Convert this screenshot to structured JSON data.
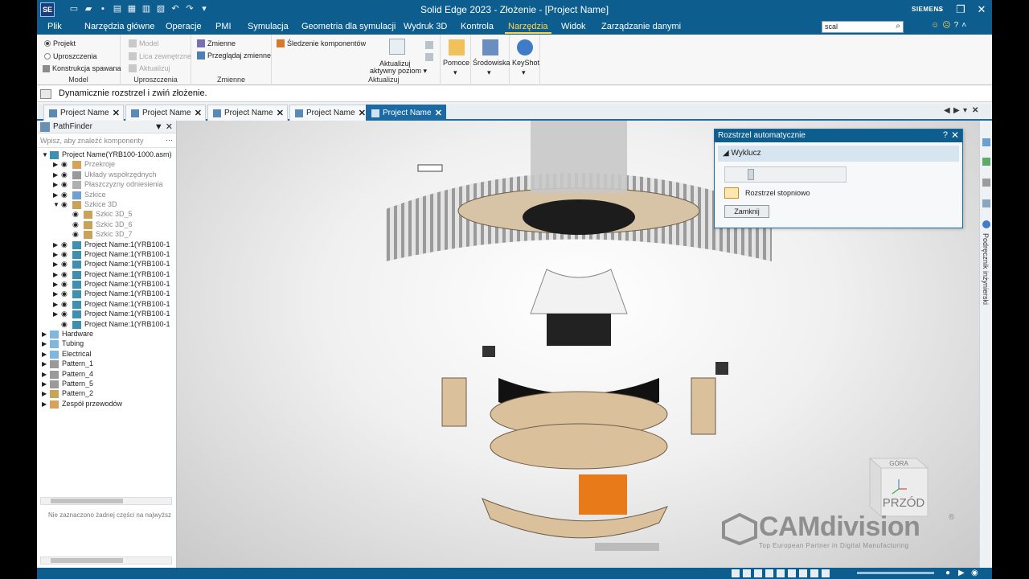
{
  "app": {
    "title": "Solid Edge 2023 - Złożenie - [Project Name]",
    "brand": "SIEMENS",
    "logo_text": "SE"
  },
  "ribbon_tabs": [
    {
      "label": "Plik"
    },
    {
      "label": "Narzędzia główne"
    },
    {
      "label": "Operacje"
    },
    {
      "label": "PMI"
    },
    {
      "label": "Symulacja"
    },
    {
      "label": "Geometria dla symulacji"
    },
    {
      "label": "Wydruk 3D"
    },
    {
      "label": "Kontrola"
    },
    {
      "label": "Narzędzia",
      "active": true
    },
    {
      "label": "Widok"
    },
    {
      "label": "Zarządzanie danymi"
    }
  ],
  "search": {
    "value": "scal"
  },
  "ribbon": {
    "model": {
      "label": "Model",
      "projekt": "Projekt",
      "uproszczenia": "Uproszczenia",
      "konstrukcja": "Konstrukcja spawana"
    },
    "uproszczenia": {
      "label": "Uproszczenia",
      "model": "Model",
      "lica": "Lica zewnętrzne",
      "aktualizuj": "Aktualizuj"
    },
    "zmienne": {
      "label": "Zmienne",
      "zmienne": "Zmienne",
      "przegladaj": "Przeglądaj zmienne"
    },
    "aktualizuj": {
      "label": "Aktualizuj",
      "sledzenie": "Śledzenie komponentów",
      "aktywny_line1": "Aktualizuj",
      "aktywny_line2": "aktywny poziom ▾"
    },
    "pomoce": "Pomoce",
    "srodowiska": "Środowiska",
    "keyshot": "KeyShot"
  },
  "command_bar": {
    "text": "Dynamicznie rozstrzel i zwiń złożenie."
  },
  "doc_tabs": [
    {
      "label": "Project Name"
    },
    {
      "label": "Project Name"
    },
    {
      "label": "Project Name"
    },
    {
      "label": "Project Name"
    },
    {
      "label": "Project Name",
      "active": true
    }
  ],
  "pathfinder": {
    "title": "PathFinder",
    "filter_placeholder": "Wpisz, aby znaleźć komponenty",
    "status": "Nie zaznaczono żadnej części na najwyższ",
    "tree": [
      {
        "label": "Project Name(YRB100-1000.asm)",
        "level": 0,
        "exp": "▼",
        "icon": "asm"
      },
      {
        "label": "Przekroje",
        "level": 1,
        "exp": "▶",
        "icon": "section",
        "grey": true
      },
      {
        "label": "Układy współrzędnych",
        "level": 1,
        "exp": "▶",
        "icon": "coord",
        "grey": true
      },
      {
        "label": "Płaszczyzny odniesienia",
        "level": 1,
        "exp": "▶",
        "icon": "plane",
        "grey": true
      },
      {
        "label": "Szkice",
        "level": 1,
        "exp": "▶",
        "icon": "sketch",
        "grey": true
      },
      {
        "label": "Szkice 3D",
        "level": 1,
        "exp": "▼",
        "icon": "sketch3d",
        "grey": true
      },
      {
        "label": "Szkic 3D_5",
        "level": 2,
        "exp": "",
        "icon": "sketch3d",
        "grey": true
      },
      {
        "label": "Szkic 3D_6",
        "level": 2,
        "exp": "",
        "icon": "sketch3d",
        "grey": true
      },
      {
        "label": "Szkic 3D_7",
        "level": 2,
        "exp": "",
        "icon": "sketch3d",
        "grey": true
      },
      {
        "label": "Project Name:1(YRB100-1",
        "level": 1,
        "exp": "▶",
        "icon": "part"
      },
      {
        "label": "Project Name:1(YRB100-1",
        "level": 1,
        "exp": "▶",
        "icon": "part"
      },
      {
        "label": "Project Name:1(YRB100-1",
        "level": 1,
        "exp": "▶",
        "icon": "part"
      },
      {
        "label": "Project Name:1(YRB100-1",
        "level": 1,
        "exp": "▶",
        "icon": "part"
      },
      {
        "label": "Project Name:1(YRB100-1",
        "level": 1,
        "exp": "▶",
        "icon": "part"
      },
      {
        "label": "Project Name:1(YRB100-1",
        "level": 1,
        "exp": "▶",
        "icon": "part"
      },
      {
        "label": "Project Name:1(YRB100-1",
        "level": 1,
        "exp": "▶",
        "icon": "part"
      },
      {
        "label": "Project Name:1(YRB100-1",
        "level": 1,
        "exp": "▶",
        "icon": "part"
      },
      {
        "label": "Project Name:1(YRB100-1",
        "level": 1,
        "exp": "",
        "icon": "part"
      },
      {
        "label": "Hardware",
        "level": 0,
        "exp": "▶",
        "icon": "folder",
        "noeye": true
      },
      {
        "label": "Tubing",
        "level": 0,
        "exp": "▶",
        "icon": "folder",
        "noeye": true
      },
      {
        "label": "Electrical",
        "level": 0,
        "exp": "▶",
        "icon": "folder",
        "noeye": true
      },
      {
        "label": "Pattern_1",
        "level": 0,
        "exp": "▶",
        "icon": "pattern",
        "noeye": true
      },
      {
        "label": "Pattern_4",
        "level": 0,
        "exp": "▶",
        "icon": "pattern",
        "noeye": true
      },
      {
        "label": "Pattern_5",
        "level": 0,
        "exp": "▶",
        "icon": "pattern",
        "noeye": true
      },
      {
        "label": "Pattern_2",
        "level": 0,
        "exp": "▶",
        "icon": "pattern2",
        "noeye": true
      },
      {
        "label": "Zespół przewodów",
        "level": 0,
        "exp": "▶",
        "icon": "wire",
        "noeye": true
      }
    ]
  },
  "dialog": {
    "title": "Rozstrzel automatycznie",
    "section": "Wyklucz",
    "option": "Rozstrzel stopniowo",
    "close_button": "Zamknij",
    "help": "?",
    "close_x": "✕",
    "slider_value": 0.2
  },
  "view_cube": {
    "top": "GÓRA",
    "front": "PRZÓD"
  },
  "watermark": {
    "name": "CAMdivision",
    "tagline": "Top European Partner in Digital Manufacturing",
    "reg": "®"
  },
  "side_tab": {
    "label": "Podręcznik inżynierski"
  },
  "colors": {
    "title_bar": "#0d5e8f",
    "active_tab_text": "#ffd34d",
    "doc_tab_active": "#1b6aa3"
  }
}
